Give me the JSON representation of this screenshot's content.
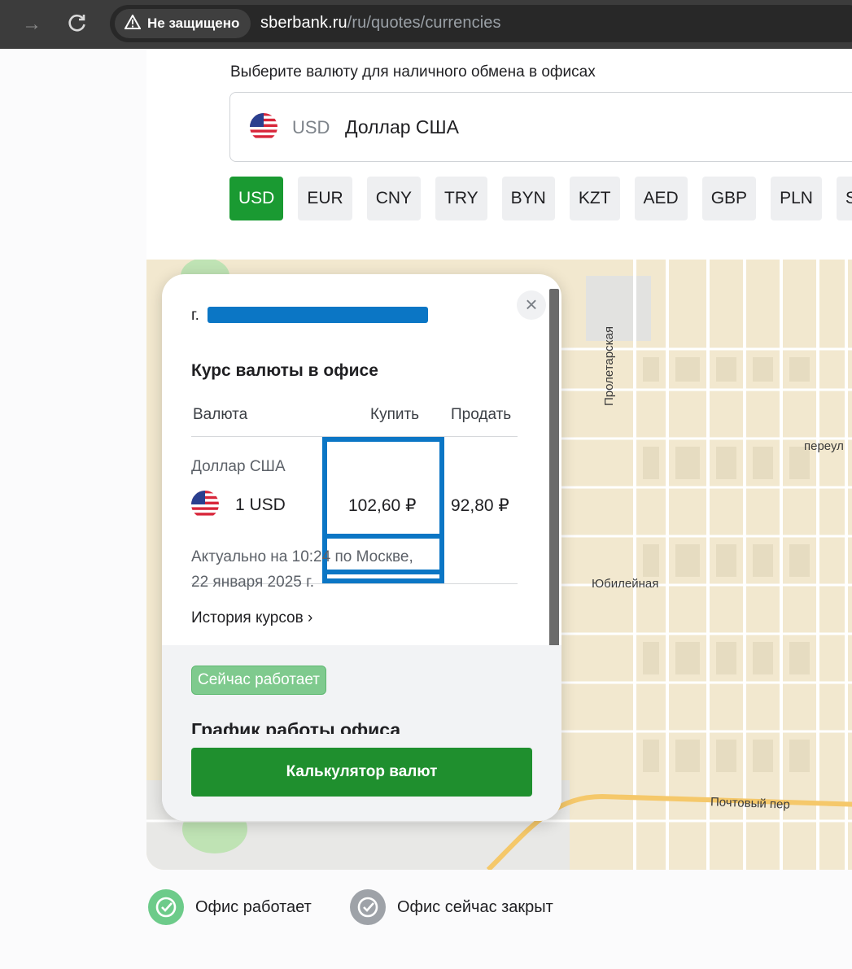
{
  "browser": {
    "security_label": "Не защищено",
    "url_host": "sberbank.ru",
    "url_path": "/ru/quotes/currencies"
  },
  "selector": {
    "label": "Выберите валюту для наличного обмена в офисах",
    "selected_code": "USD",
    "selected_name": "Доллар США"
  },
  "currency_chips": [
    "USD",
    "EUR",
    "CNY",
    "TRY",
    "BYN",
    "KZT",
    "AED",
    "GBP",
    "PLN",
    "SG"
  ],
  "map": {
    "labels": [
      "Пролетарская",
      "переул",
      "Юбилейная",
      "Почтовый пер"
    ]
  },
  "popup": {
    "city_prefix": "г.",
    "rate_title": "Курс валюты в офисе",
    "col_currency": "Валюта",
    "col_buy": "Купить",
    "col_sell": "Продать",
    "currency_name": "Доллар США",
    "unit": "1 USD",
    "buy": "102,60 ₽",
    "sell": "92,80 ₽",
    "updated_line1": "Актуально на 10:24 по Москве,",
    "updated_line2": "22 января 2025 г.",
    "history_link": "История курсов ›",
    "status": "Сейчас работает",
    "schedule_title": "График работы офиса",
    "calc_button": "Калькулятор валют",
    "close": "×"
  },
  "legend": {
    "open": "Офис работает",
    "closed": "Офис сейчас закрыт"
  },
  "colors": {
    "accent": "#1a9a32",
    "highlight": "#0b76c5"
  }
}
